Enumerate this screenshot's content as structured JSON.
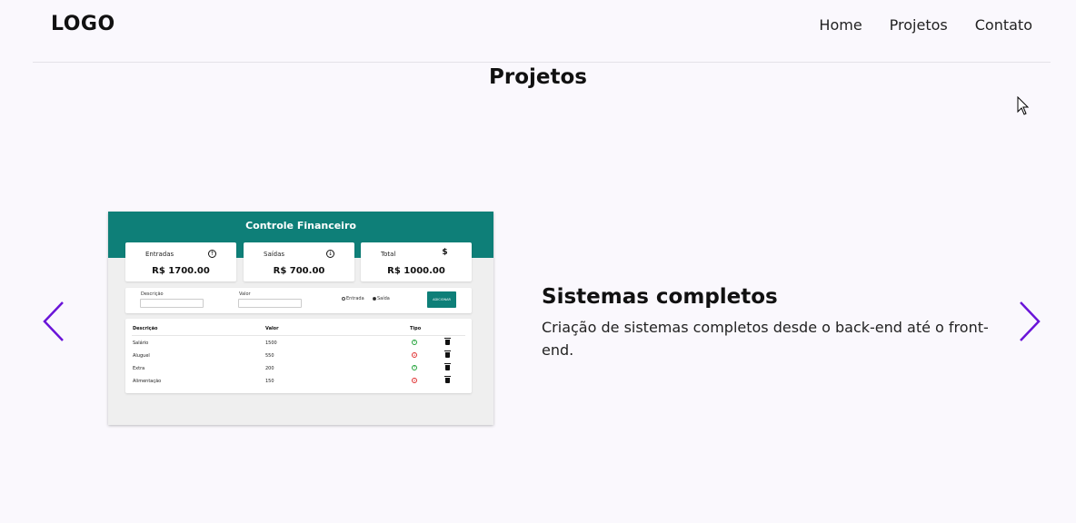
{
  "header": {
    "logo": "LOGO",
    "nav": [
      {
        "label": "Home"
      },
      {
        "label": "Projetos"
      },
      {
        "label": "Contato"
      }
    ]
  },
  "section": {
    "title": "Projetos"
  },
  "carousel": {
    "prev_icon": "chevron-left-icon",
    "next_icon": "chevron-right-icon",
    "arrow_color": "#6a14d8",
    "project": {
      "title": "Sistemas completos",
      "description": "Criação de sistemas completos desde o back-end até o front-end.",
      "preview": {
        "app_title": "Controle Financeiro",
        "accent_color": "#0e7f78",
        "cards": [
          {
            "label": "Entradas",
            "icon": "arrow-up-circle-icon",
            "value": "R$ 1700.00"
          },
          {
            "label": "Saídas",
            "icon": "arrow-down-circle-icon",
            "value": "R$ 700.00"
          },
          {
            "label": "Total",
            "icon": "dollar-icon",
            "value": "R$ 1000.00"
          }
        ],
        "form": {
          "description_label": "Descrição",
          "value_label": "Valor",
          "radio_in": "Entrada",
          "radio_out": "Saída",
          "button": "ADICIONAR"
        },
        "table": {
          "headers": [
            "Descrição",
            "Valor",
            "Tipo"
          ],
          "rows": [
            {
              "desc": "Salário",
              "value": "1500",
              "type": "in"
            },
            {
              "desc": "Aluguel",
              "value": "550",
              "type": "out"
            },
            {
              "desc": "Extra",
              "value": "200",
              "type": "in"
            },
            {
              "desc": "Alimentação",
              "value": "150",
              "type": "out"
            }
          ]
        }
      }
    }
  }
}
